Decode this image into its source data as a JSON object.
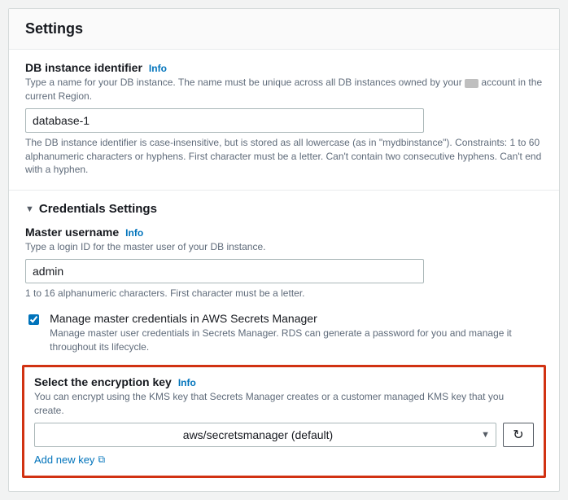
{
  "panel": {
    "title": "Settings"
  },
  "identifier": {
    "label": "DB instance identifier",
    "info": "Info",
    "hint_pre": "Type a name for your DB instance. The name must be unique across all DB instances owned by your ",
    "hint_post": " account in the current Region.",
    "value": "database-1",
    "constraint": "The DB instance identifier is case-insensitive, but is stored as all lowercase (as in \"mydbinstance\"). Constraints: 1 to 60 alphanumeric characters or hyphens. First character must be a letter. Can't contain two consecutive hyphens. Can't end with a hyphen."
  },
  "credentials": {
    "section_title": "Credentials Settings",
    "username_label": "Master username",
    "username_info": "Info",
    "username_hint": "Type a login ID for the master user of your DB instance.",
    "username_value": "admin",
    "username_constraint": "1 to 16 alphanumeric characters. First character must be a letter.",
    "manage_label": "Manage master credentials in AWS Secrets Manager",
    "manage_desc": "Manage master user credentials in Secrets Manager. RDS can generate a password for you and manage it throughout its lifecycle."
  },
  "encryption": {
    "label": "Select the encryption key",
    "info": "Info",
    "hint": "You can encrypt using the KMS key that Secrets Manager creates or a customer managed KMS key that you create.",
    "selected": "aws/secretsmanager (default)",
    "add_link": "Add new key"
  }
}
